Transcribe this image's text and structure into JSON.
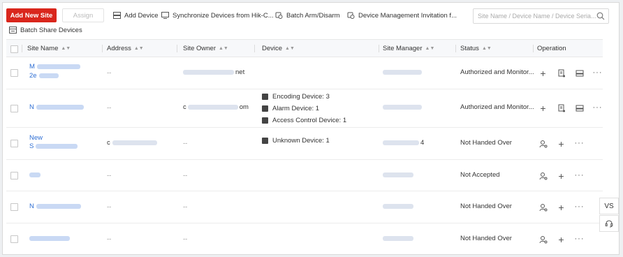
{
  "toolbar": {
    "add_site": "Add New Site",
    "assign": "Assign",
    "add_device": "Add Device",
    "sync_devices": "Synchronize Devices from Hik-C...",
    "batch_arm": "Batch Arm/Disarm",
    "invitation": "Device Management Invitation f...",
    "search_placeholder": "Site Name / Device Name / Device Seria...",
    "batch_share": "Batch Share Devices"
  },
  "columns": {
    "site_name": "Site Name",
    "address": "Address",
    "site_owner": "Site Owner",
    "device": "Device",
    "site_manager": "Site Manager",
    "status": "Status",
    "operation": "Operation"
  },
  "rows": [
    {
      "site_name_a": "M",
      "site_name_b": "2e",
      "address": "--",
      "owner": "net",
      "devices": [],
      "status": "Authorized and Monitor...",
      "ops": "authorized"
    },
    {
      "site_name_a": "N",
      "address": "--",
      "owner_prefix": "c",
      "owner": "om",
      "devices": [
        {
          "icon": "encoding-device-icon",
          "label": "Encoding Device: 3"
        },
        {
          "icon": "alarm-device-icon",
          "label": "Alarm Device: 1"
        },
        {
          "icon": "access-control-device-icon",
          "label": "Access Control Device: 1"
        }
      ],
      "status": "Authorized and Monitor...",
      "ops": "authorized"
    },
    {
      "site_name_a": "New",
      "site_name_b": "S",
      "address_prefix": "c",
      "owner": "--",
      "devices": [
        {
          "icon": "unknown-device-icon",
          "label": "Unknown Device: 1"
        }
      ],
      "manager_suffix": "4",
      "status": "Not Handed Over",
      "ops": "handover"
    },
    {
      "site_name_a": "",
      "address": "--",
      "owner": "--",
      "devices": [],
      "status": "Not Accepted",
      "ops": "handover"
    },
    {
      "site_name_a": "N",
      "address": "--",
      "owner": "--",
      "devices": [],
      "status": "Not Handed Over",
      "ops": "handover"
    },
    {
      "site_name_a": "",
      "address": "--",
      "owner": "--",
      "devices": [],
      "status": "Not Handed Over",
      "ops": "handover"
    }
  ],
  "float": {
    "vs": "VS"
  }
}
